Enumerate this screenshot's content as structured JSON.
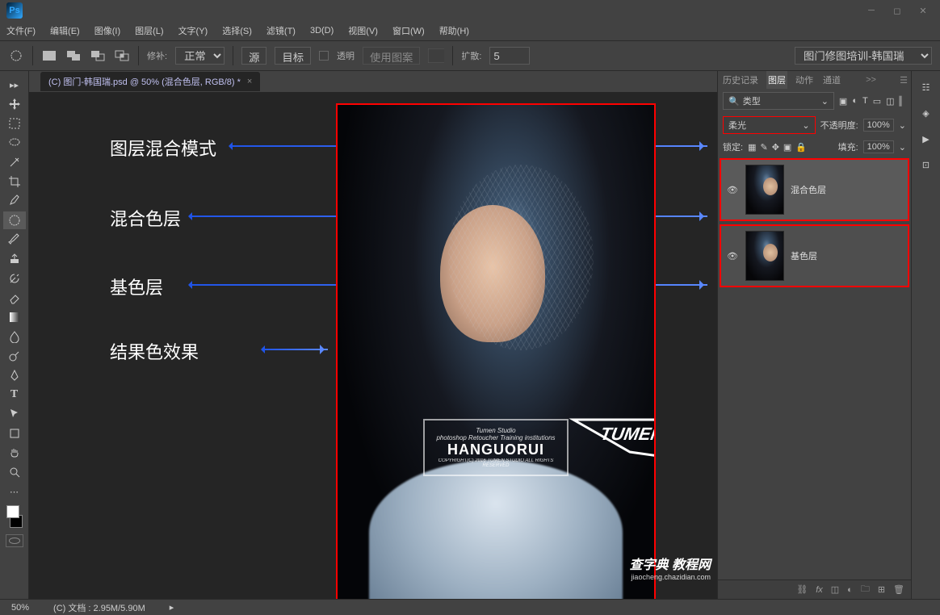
{
  "title_bar": {
    "logo": "Ps"
  },
  "menu": [
    "文件(F)",
    "编辑(E)",
    "图像(I)",
    "图层(L)",
    "文字(Y)",
    "选择(S)",
    "滤镜(T)",
    "3D(D)",
    "视图(V)",
    "窗口(W)",
    "帮助(H)"
  ],
  "options": {
    "repair_label": "修补:",
    "repair_mode": "正常",
    "source_btn": "源",
    "target_btn": "目标",
    "transparent_label": "透明",
    "use_pattern": "使用图案",
    "diffuse_label": "扩散:",
    "diffuse_value": "5",
    "right_select": "图门修图培训-韩国瑞"
  },
  "doc_tab": {
    "title": "(C) 图门-韩国瑞.psd @ 50% (混合色层, RGB/8) *"
  },
  "annotations": {
    "blend_mode": "图层混合模式",
    "blend_layer": "混合色层",
    "base_layer": "基色层",
    "result_color": "结果色效果"
  },
  "watermark": {
    "line1": "Tumen Studio",
    "line2": "photoshop Retoucher Training institutions",
    "line3": "HANGUORUI",
    "line4": "COPYRIGHT(C) 2016 TUMEN STUDIO ALL RIGHTS RESERVED"
  },
  "panels": {
    "tabs": [
      "历史记录",
      "图层",
      "动作",
      "通道"
    ],
    "active_tab": "图层",
    "filter": {
      "icon_label": "🔍",
      "type_label": "类型"
    },
    "blend_mode": "柔光",
    "opacity_label": "不透明度:",
    "opacity_value": "100%",
    "lock_label": "锁定:",
    "fill_label": "填充:",
    "fill_value": "100%",
    "layers": [
      {
        "name": "混合色层",
        "visible": true
      },
      {
        "name": "基色层",
        "visible": true
      }
    ]
  },
  "status": {
    "zoom": "50%",
    "doc_info": "(C) 文档 : 2.95M/5.90M"
  },
  "footer_watermark": {
    "main": "查字典 教程网",
    "sub": "jiaocheng.chazidian.com"
  },
  "panel_more": ">>"
}
